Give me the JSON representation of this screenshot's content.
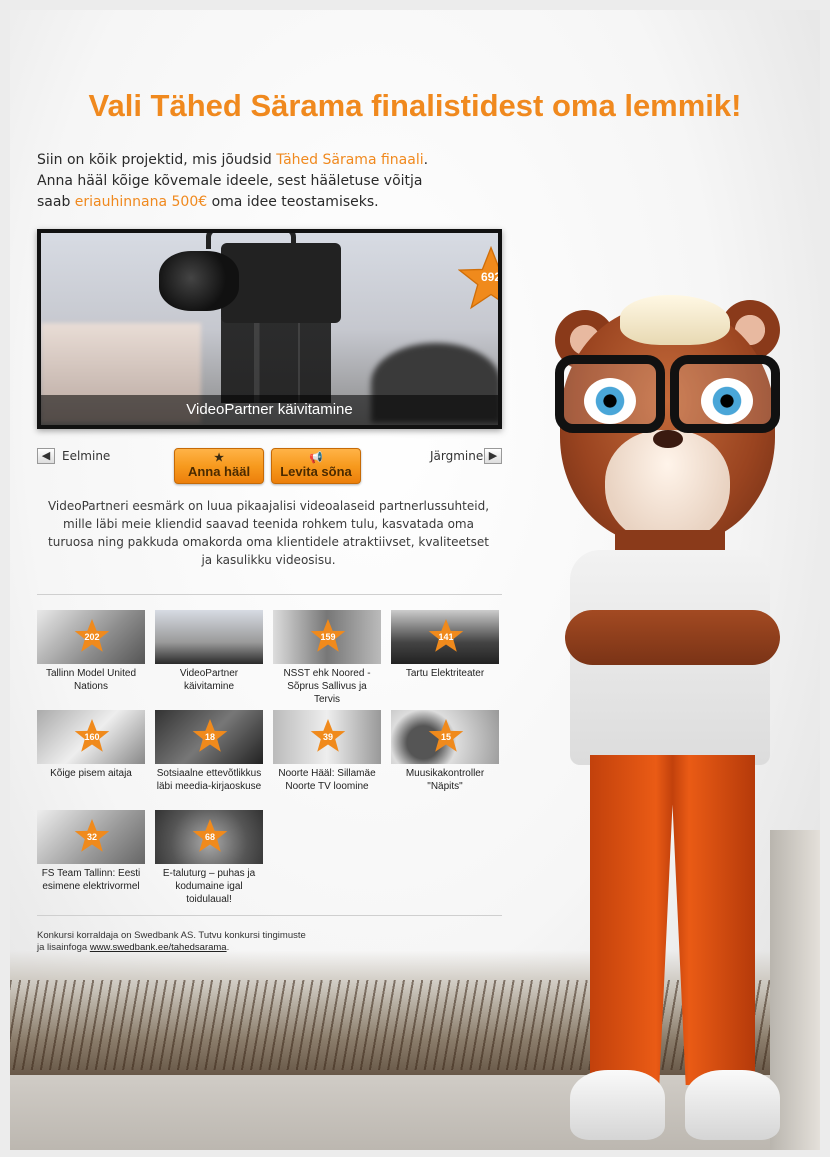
{
  "headline": {
    "part1": "Vali ",
    "part2": "Tähed Särama finalistidest",
    "part3": " oma lemmik!"
  },
  "intro": {
    "line1_a": "Siin on kõik projektid, mis jõudsid ",
    "line1_hl": "Tähed Särama finaali",
    "line1_b": ".",
    "line2": "Anna hääl kõige kõvemale ideele, sest hääletuse võitja",
    "line3_a": "saab ",
    "line3_hl": "eriauhinnana 500€",
    "line3_b": " oma idee teostamiseks."
  },
  "featured": {
    "title": "VideoPartner käivitamine",
    "votes": "692"
  },
  "nav": {
    "prev_label": "Eelmine",
    "next_label": "Järgmine",
    "vote_label": "Anna hääl",
    "share_label": "Levita sõna",
    "prev_icon": "arrow-left-icon",
    "next_icon": "arrow-right-icon"
  },
  "description": "VideoPartneri eesmärk on luua pikaajalisi videoalaseid partnerlussuhteid, mille läbi meie kliendid saavad teenida rohkem tulu, kasvatada oma turuosa ning pakkuda omakorda oma klientidele atraktiivset, kvaliteetset ja kasulikku videosisu.",
  "projects": [
    {
      "title": "Tallinn Model United Nations",
      "votes": "202"
    },
    {
      "title": "VideoPartner käivitamine",
      "votes": ""
    },
    {
      "title": "NSST ehk Noored - Sõprus Sallivus ja Tervis",
      "votes": "159"
    },
    {
      "title": "Tartu Elektriteater",
      "votes": "141"
    },
    {
      "title": "Kõige pisem aitaja",
      "votes": "160"
    },
    {
      "title": "Sotsiaalne ettevõtlikkus läbi meedia-kirjaoskuse",
      "votes": "18"
    },
    {
      "title": "Noorte Hääl: Sillamäe Noorte TV loomine",
      "votes": "39"
    },
    {
      "title": "Muusikakontroller \"Näpits\"",
      "votes": "15"
    },
    {
      "title": "FS Team Tallinn: Eesti esimene elektrivormel",
      "votes": "32"
    },
    {
      "title": "E-taluturg – puhas ja kodumaine igal toidulaual!",
      "votes": "68"
    }
  ],
  "footer": {
    "text1": "Konkursi korraldaja on Swedbank AS. Tutvu konkursi tingimuste",
    "text2": "ja lisainfoga ",
    "link": "www.swedbank.ee/tahedsarama",
    "text3": "."
  },
  "colors": {
    "accent": "#f0891e",
    "star": "#f08a1c"
  }
}
